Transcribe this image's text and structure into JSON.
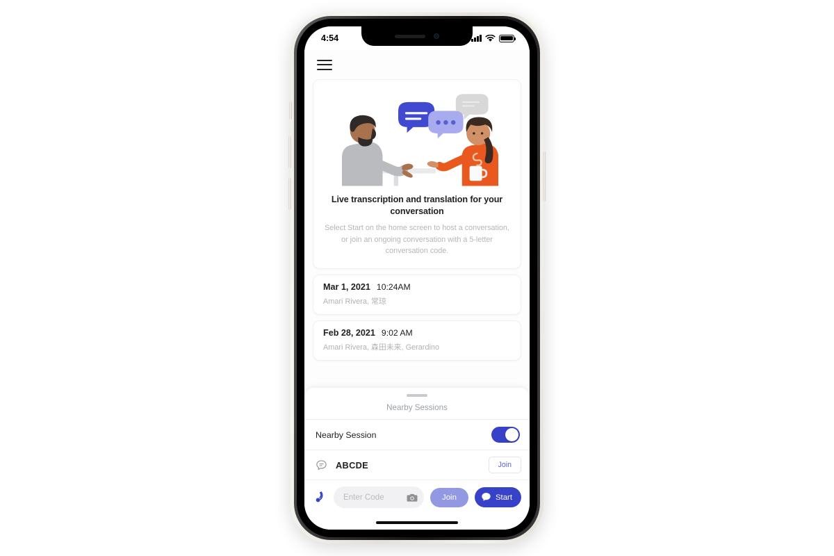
{
  "status_bar": {
    "time": "4:54",
    "signal_icon": "cellular-signal-icon",
    "wifi_icon": "wifi-icon",
    "battery_icon": "battery-full-icon"
  },
  "app_bar": {
    "menu_icon": "hamburger-menu-icon"
  },
  "hero": {
    "illustration_alt": "two-people-conversation-illustration",
    "title": "Live transcription and translation for your conversation",
    "subtitle": "Select Start on the home screen to host a conversation, or join an ongoing conversation with a 5-letter conversation code."
  },
  "sessions": [
    {
      "date": "Mar 1, 2021",
      "time": "10:24AM",
      "participants": "Amari Rivera, 常琼"
    },
    {
      "date": "Feb 28, 2021",
      "time": "9:02 AM",
      "participants": "Amari Rivera, 森田未来, Gerardino"
    }
  ],
  "nearby_sheet": {
    "handle": "drag-handle",
    "title": "Nearby Sessions",
    "toggle_label": "Nearby Session",
    "toggle_on": true,
    "items": [
      {
        "icon": "chat-bubble-icon",
        "code": "ABCDE",
        "join_label": "Join"
      }
    ]
  },
  "action_bar": {
    "nearby_icon": "nearby-broadcast-icon",
    "code_value": "",
    "code_placeholder": "Enter Code",
    "camera_icon": "camera-icon",
    "join_label": "Join",
    "start_label": "Start",
    "start_icon": "chat-bubble-filled-icon"
  },
  "colors": {
    "accent": "#3742c8",
    "accent_light": "#9298e2",
    "orange": "#e8581f",
    "bubble_blue": "#4049cf",
    "bubble_periwinkle": "#a9abef",
    "bubble_grey": "#d8d8d8",
    "text_primary": "#202124",
    "text_muted": "#b4b6ba"
  }
}
